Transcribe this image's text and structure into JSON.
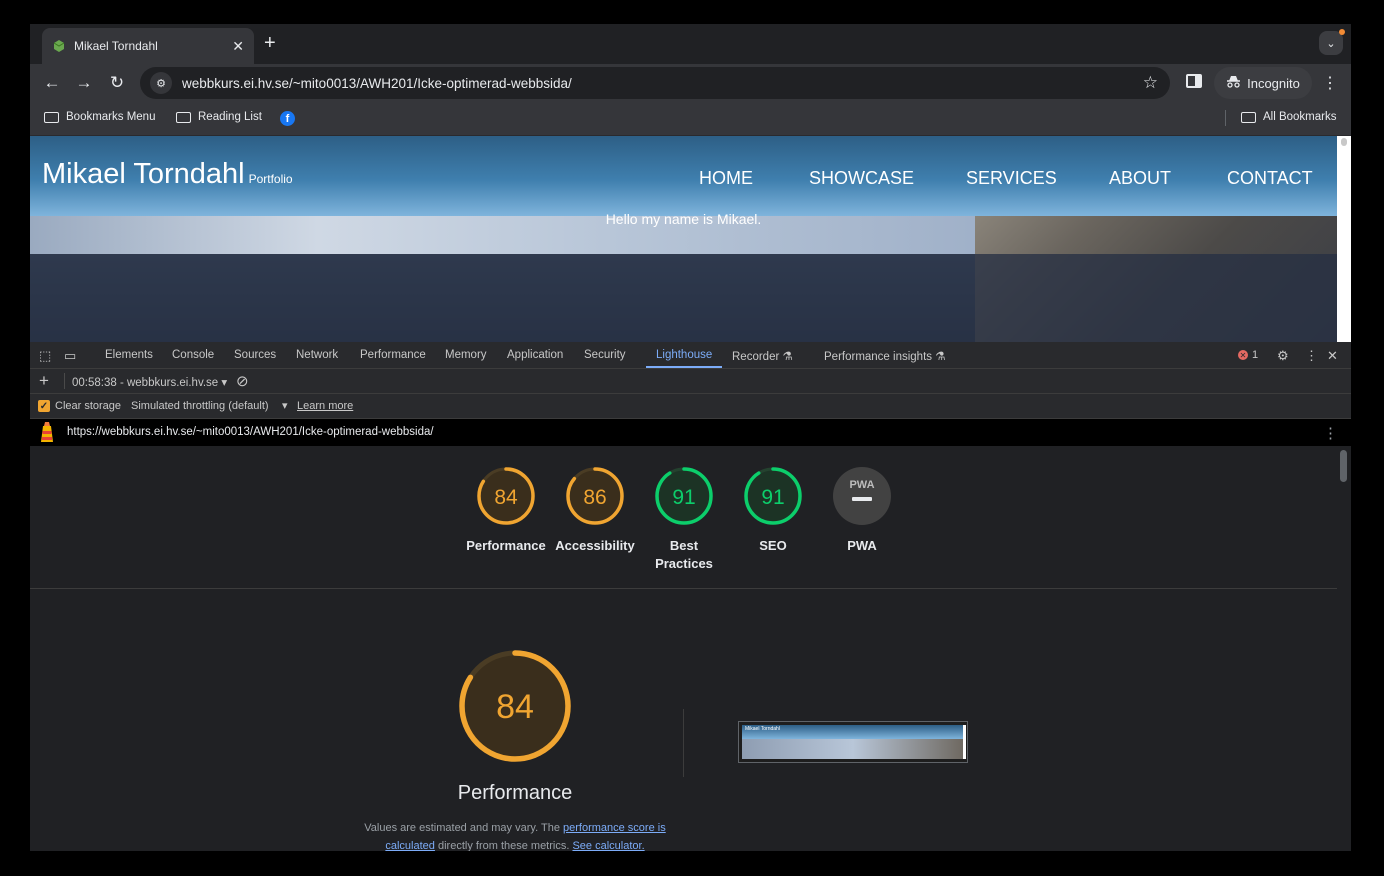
{
  "browser": {
    "tab_title": "Mikael Torndahl",
    "url": "webbkurs.ei.hv.se/~mito0013/AWH201/Icke-optimerad-webbsida/",
    "incognito_label": "Incognito",
    "bookmarks": [
      "Bookmarks Menu",
      "Reading List"
    ],
    "all_bookmarks": "All Bookmarks"
  },
  "site": {
    "name": "Mikael Torndahl",
    "subtitle": "Portfolio",
    "nav": [
      "HOME",
      "SHOWCASE",
      "SERVICES",
      "ABOUT",
      "CONTACT"
    ],
    "hero_text": "Hello my name is Mikael."
  },
  "devtools": {
    "tabs": [
      "Elements",
      "Console",
      "Sources",
      "Network",
      "Performance",
      "Memory",
      "Application",
      "Security",
      "Lighthouse",
      "Recorder",
      "Performance insights"
    ],
    "active_tab": "Lighthouse",
    "error_count": "1",
    "report_selector": "00:58:38 - webbkurs.ei.hv.se",
    "clear_storage": "Clear storage",
    "throttling": "Simulated throttling (default)",
    "learn_more": "Learn more",
    "report_url": "https://webbkurs.ei.hv.se/~mito0013/AWH201/Icke-optimerad-webbsida/"
  },
  "lighthouse": {
    "scores": [
      {
        "label": "Performance",
        "score": 84,
        "color": "#f0a531"
      },
      {
        "label": "Accessibility",
        "score": 86,
        "color": "#f0a531"
      },
      {
        "label": "Best Practices",
        "score": 91,
        "color": "#0cce6b"
      },
      {
        "label": "SEO",
        "score": 91,
        "color": "#0cce6b"
      },
      {
        "label": "PWA",
        "score": null,
        "color": "#9aa0a6"
      }
    ],
    "pwa_text": "PWA",
    "main": {
      "score": "84",
      "label": "Performance",
      "note_prefix": "Values are estimated and may vary. The",
      "note_link1": "performance score is calculated",
      "note_middle": "directly from these metrics.",
      "note_link2": "See calculator."
    },
    "thumbnail_title": "Mikael Torndahl"
  },
  "colors": {
    "average": "#f0a531",
    "pass": "#0cce6b",
    "accent": "#7cacf8"
  }
}
